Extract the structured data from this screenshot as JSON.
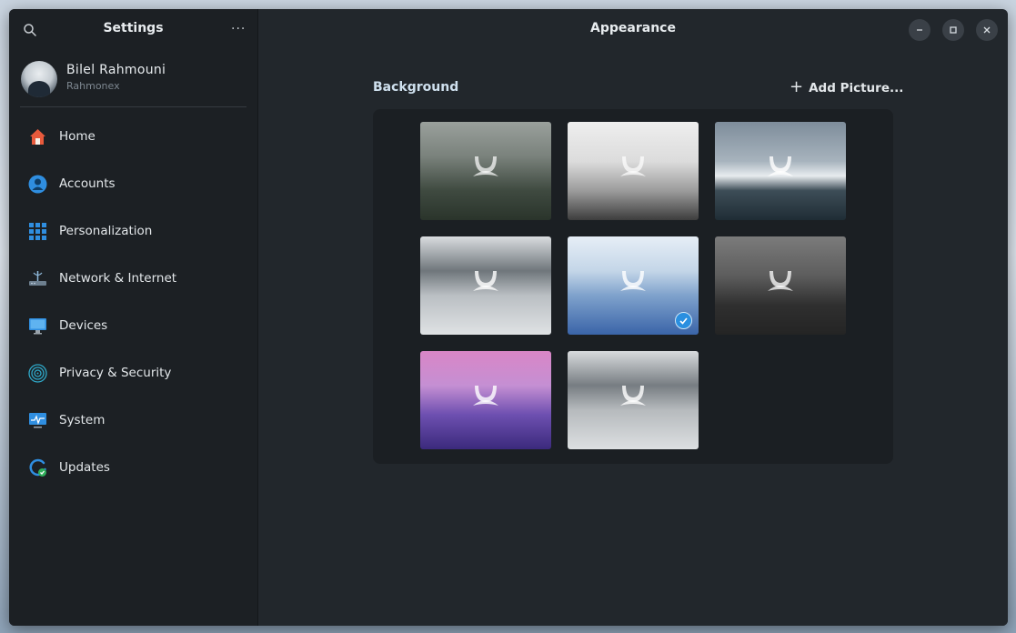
{
  "sidebar": {
    "title": "Settings",
    "more_label": "···",
    "user": {
      "name": "Bilel Rahmouni",
      "handle": "Rahmonex"
    },
    "items": [
      {
        "label": "Home",
        "icon": "home-icon",
        "color": "#e85a3c"
      },
      {
        "label": "Accounts",
        "icon": "account-icon",
        "color": "#2f8ee0"
      },
      {
        "label": "Personalization",
        "icon": "grid-icon",
        "color": "#2f8ee0"
      },
      {
        "label": "Network & Internet",
        "icon": "router-icon",
        "color": "#8fb8da"
      },
      {
        "label": "Devices",
        "icon": "monitor-icon",
        "color": "#2f8ee0"
      },
      {
        "label": "Privacy & Security",
        "icon": "fingerprint-icon",
        "color": "#2fa8c8"
      },
      {
        "label": "System",
        "icon": "system-monitor-icon",
        "color": "#2f8ee0"
      },
      {
        "label": "Updates",
        "icon": "updates-icon",
        "color": "#2f8ee0"
      }
    ]
  },
  "header": {
    "title": "Appearance"
  },
  "main": {
    "background_title": "Background",
    "add_picture_label": "Add Picture...",
    "wallpapers": [
      {
        "name": "foggy-forest",
        "selected": false
      },
      {
        "name": "misty-hills",
        "selected": false
      },
      {
        "name": "snowy-ridge",
        "selected": false
      },
      {
        "name": "cloud-peaks",
        "selected": false
      },
      {
        "name": "blue-mountains",
        "selected": true
      },
      {
        "name": "dark-peak",
        "selected": false
      },
      {
        "name": "purple-mountains",
        "selected": false
      },
      {
        "name": "cloud-peaks-2",
        "selected": false
      }
    ]
  },
  "colors": {
    "accent": "#2a8fe0",
    "window_bg": "#22272c",
    "sidebar_bg": "#1c2024"
  }
}
